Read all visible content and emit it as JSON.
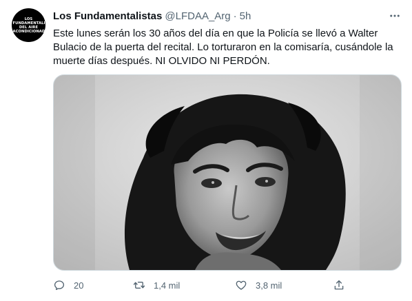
{
  "author": {
    "display_name": "Los Fundamentalistas",
    "handle": "@LFDAA_Arg",
    "separator": "·",
    "time": "5h",
    "avatar_lines": [
      "LOS",
      "FUNDAMENTALISTAS",
      "DEL AIRE",
      "ACONDICIONADO"
    ]
  },
  "tweet": {
    "lines": [
      "Este lunes serán los 30 años del día en que la Policía se llevó a Walter",
      "Bulacio de la puerta del recital. Lo torturaron en la comisaría, cusándole la",
      "muerte días después. NI OLVIDO NI PERDÓN."
    ]
  },
  "media": {
    "kind": "photo",
    "style": "black-and-white portrait"
  },
  "actions": {
    "reply_count": "20",
    "retweet_count": "1,4 mil",
    "like_count": "3,8 mil"
  },
  "icons": [
    "more-icon",
    "reply-icon",
    "retweet-icon",
    "like-icon",
    "share-icon"
  ],
  "colors": {
    "text": "#0f1419",
    "secondary": "#536471",
    "border": "#cfd9de"
  }
}
